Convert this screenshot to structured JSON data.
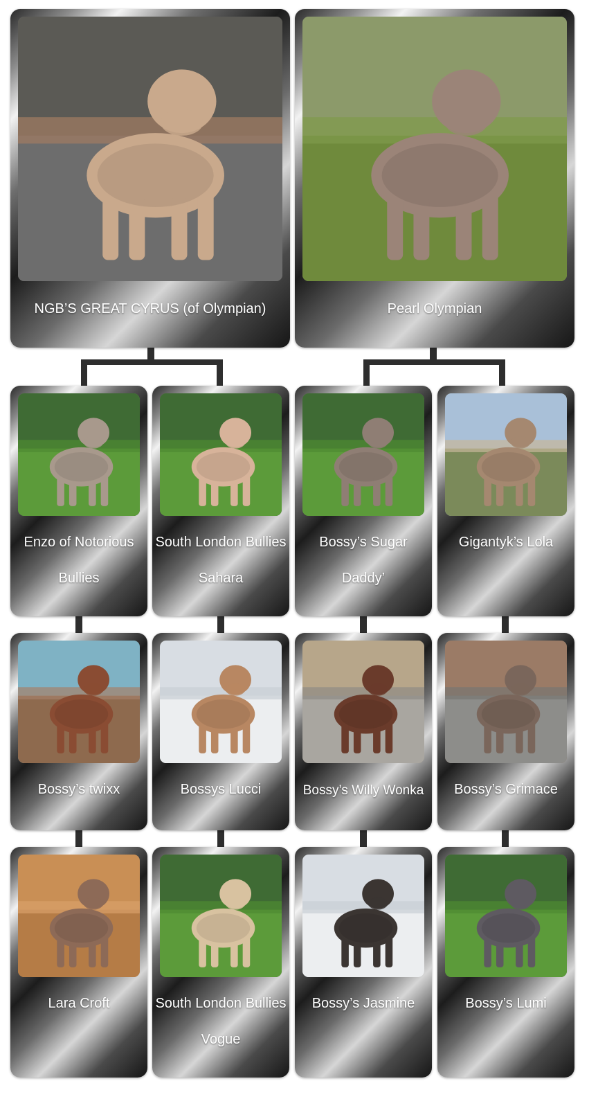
{
  "parents": [
    {
      "name": "NGB’S GREAT CYRUS (of Olympian)",
      "scene": "street",
      "dog": "#c9a98c"
    },
    {
      "name": "Pearl Olympian",
      "scene": "field",
      "dog": "#9b8478"
    }
  ],
  "litters": [
    {
      "name": "Enzo of Notorious Bullies",
      "scene": "grass",
      "dog": "#a8998c"
    },
    {
      "name": "South London Bullies Sahara",
      "scene": "grass",
      "dog": "#d7b39a"
    },
    {
      "name": "Bossy’s Sugar Daddy’",
      "scene": "grass",
      "dog": "#8f7e74"
    },
    {
      "name": "Gigantyk’s Lola",
      "scene": "sky",
      "dog": "#a58870"
    },
    {
      "name": "Bossy’s twixx",
      "scene": "beach",
      "dog": "#8a4c33"
    },
    {
      "name": "Bossys Lucci",
      "scene": "snow",
      "dog": "#b88762"
    },
    {
      "name": "Bossy’s Willy Wonka",
      "scene": "gravel",
      "dog": "#6a3b2b"
    },
    {
      "name": "Bossy’s Grimace",
      "scene": "pavement",
      "dog": "#7a665b"
    },
    {
      "name": "Lara Croft",
      "scene": "wood",
      "dog": "#8d6a57"
    },
    {
      "name": "South London Bullies Vogue",
      "scene": "grass",
      "dog": "#d8c2a0"
    },
    {
      "name": "Bossy’s Jasmine",
      "scene": "snow",
      "dog": "#3b3532"
    },
    {
      "name": "Bossy’s Lumi",
      "scene": "grass",
      "dog": "#5e5a61"
    }
  ],
  "colors": {
    "connector": "#2e2e2e",
    "label": "#ffffff"
  }
}
